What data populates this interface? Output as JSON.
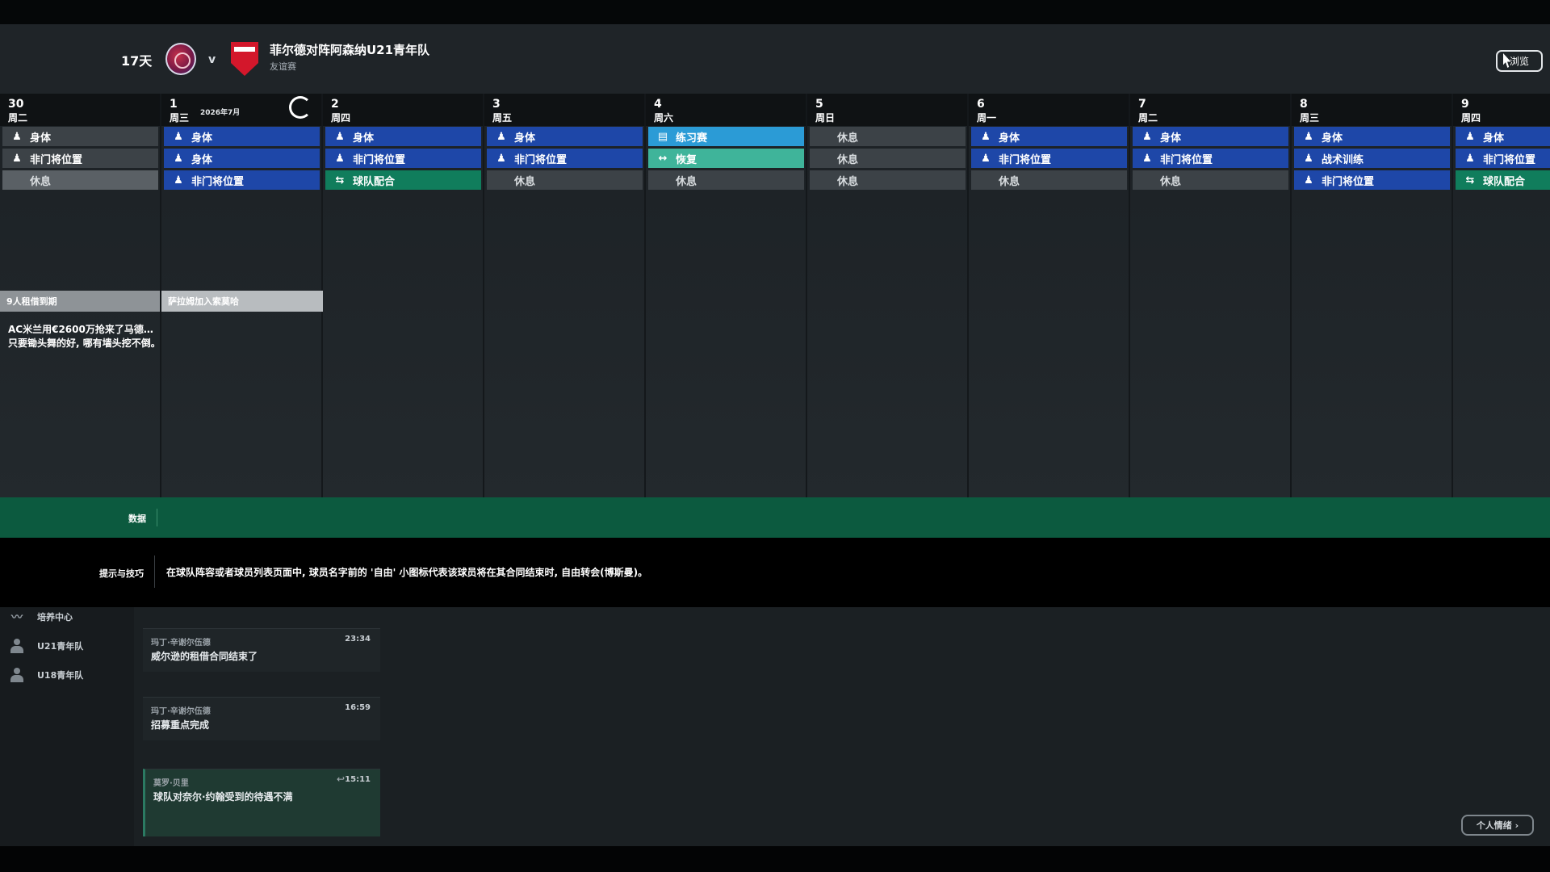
{
  "header": {
    "days_left": "17天",
    "versus": "v",
    "match_title": "菲尔德对阵阿森纳U21青年队",
    "match_subtitle": "友谊赛",
    "browse_label": "浏览"
  },
  "calendar": {
    "month_label": "2026年7月",
    "days": [
      {
        "num": "30",
        "weekday": "周二",
        "sessions": [
          {
            "label": "身体",
            "type": "blue-dark",
            "icon": "person-icon"
          },
          {
            "label": "非门将位置",
            "type": "blue-dark",
            "icon": "person-icon"
          },
          {
            "label": "休息",
            "type": "rest",
            "icon": "none"
          }
        ]
      },
      {
        "num": "1",
        "weekday": "周三",
        "sessions": [
          {
            "label": "身体",
            "type": "blue",
            "icon": "person-icon"
          },
          {
            "label": "身体",
            "type": "blue",
            "icon": "person-icon"
          },
          {
            "label": "非门将位置",
            "type": "blue",
            "icon": "person-icon"
          }
        ]
      },
      {
        "num": "2",
        "weekday": "周四",
        "sessions": [
          {
            "label": "身体",
            "type": "blue",
            "icon": "person-icon"
          },
          {
            "label": "非门将位置",
            "type": "blue",
            "icon": "person-icon"
          },
          {
            "label": "球队配合",
            "type": "green",
            "icon": "team-play-icon"
          }
        ]
      },
      {
        "num": "3",
        "weekday": "周五",
        "sessions": [
          {
            "label": "身体",
            "type": "blue",
            "icon": "person-icon"
          },
          {
            "label": "非门将位置",
            "type": "blue",
            "icon": "person-icon"
          },
          {
            "label": "休息",
            "type": "rest",
            "icon": "none"
          }
        ]
      },
      {
        "num": "4",
        "weekday": "周六",
        "sessions": [
          {
            "label": "练习赛",
            "type": "lightblue",
            "icon": "match-sheet-icon"
          },
          {
            "label": "恢复",
            "type": "teal",
            "icon": "recovery-icon"
          },
          {
            "label": "休息",
            "type": "rest",
            "icon": "none"
          }
        ]
      },
      {
        "num": "5",
        "weekday": "周日",
        "sessions": [
          {
            "label": "休息",
            "type": "rest",
            "icon": "none"
          },
          {
            "label": "休息",
            "type": "rest",
            "icon": "none"
          },
          {
            "label": "休息",
            "type": "rest",
            "icon": "none"
          }
        ]
      },
      {
        "num": "6",
        "weekday": "周一",
        "sessions": [
          {
            "label": "身体",
            "type": "blue",
            "icon": "person-icon"
          },
          {
            "label": "非门将位置",
            "type": "blue",
            "icon": "person-icon"
          },
          {
            "label": "休息",
            "type": "rest",
            "icon": "none"
          }
        ]
      },
      {
        "num": "7",
        "weekday": "周二",
        "sessions": [
          {
            "label": "身体",
            "type": "blue",
            "icon": "person-icon"
          },
          {
            "label": "非门将位置",
            "type": "blue",
            "icon": "person-icon"
          },
          {
            "label": "休息",
            "type": "rest",
            "icon": "none"
          }
        ]
      },
      {
        "num": "8",
        "weekday": "周三",
        "sessions": [
          {
            "label": "身体",
            "type": "blue",
            "icon": "person-icon"
          },
          {
            "label": "战术训练",
            "type": "blue",
            "icon": "person-icon"
          },
          {
            "label": "非门将位置",
            "type": "blue",
            "icon": "person-icon"
          }
        ]
      },
      {
        "num": "9",
        "weekday": "周四",
        "sessions": [
          {
            "label": "身体",
            "type": "blue",
            "icon": "person-icon"
          },
          {
            "label": "非门将位置",
            "type": "blue",
            "icon": "person-icon"
          },
          {
            "label": "球队配合",
            "type": "green",
            "icon": "team-play-icon"
          }
        ]
      }
    ],
    "events": [
      "9人租借到期",
      "萨拉姆加入索莫哈"
    ],
    "news": "AC米兰用€2600万抢来了马德… 只要锄头舞的好, 哪有墙头挖不倒。"
  },
  "data_bar": {
    "label": "数据"
  },
  "tips": {
    "label": "提示与技巧",
    "text": "在球队阵容或者球员列表页面中, 球员名字前的 '自由' 小图标代表该球员将在其合同结束时, 自由转会(博斯曼)。"
  },
  "sidebar": {
    "items": [
      {
        "label": "培养中心",
        "icon": "development-icon"
      },
      {
        "label": "U21青年队",
        "icon": "team-icon"
      },
      {
        "label": "U18青年队",
        "icon": "team-icon"
      }
    ]
  },
  "messages": [
    {
      "sender": "玛丁·辛谢尔伍德",
      "time": "23:34",
      "body": "威尔逊的租借合同结束了"
    },
    {
      "sender": "玛丁·辛谢尔伍德",
      "time": "16:59",
      "body": "招募重点完成"
    },
    {
      "sender": "莫罗·贝里",
      "time": "15:11",
      "body": "球队对奈尔·约翰受到的待遇不满"
    }
  ],
  "mood_button": {
    "label": "个人情绪 ›"
  },
  "colors": {
    "session_blue": "#1e47a8",
    "session_rest": "#3c4247",
    "session_green": "#107d5c",
    "session_lightblue": "#2b9bd6",
    "session_teal": "#3fb49a",
    "data_bar": "#0c5a3f"
  }
}
